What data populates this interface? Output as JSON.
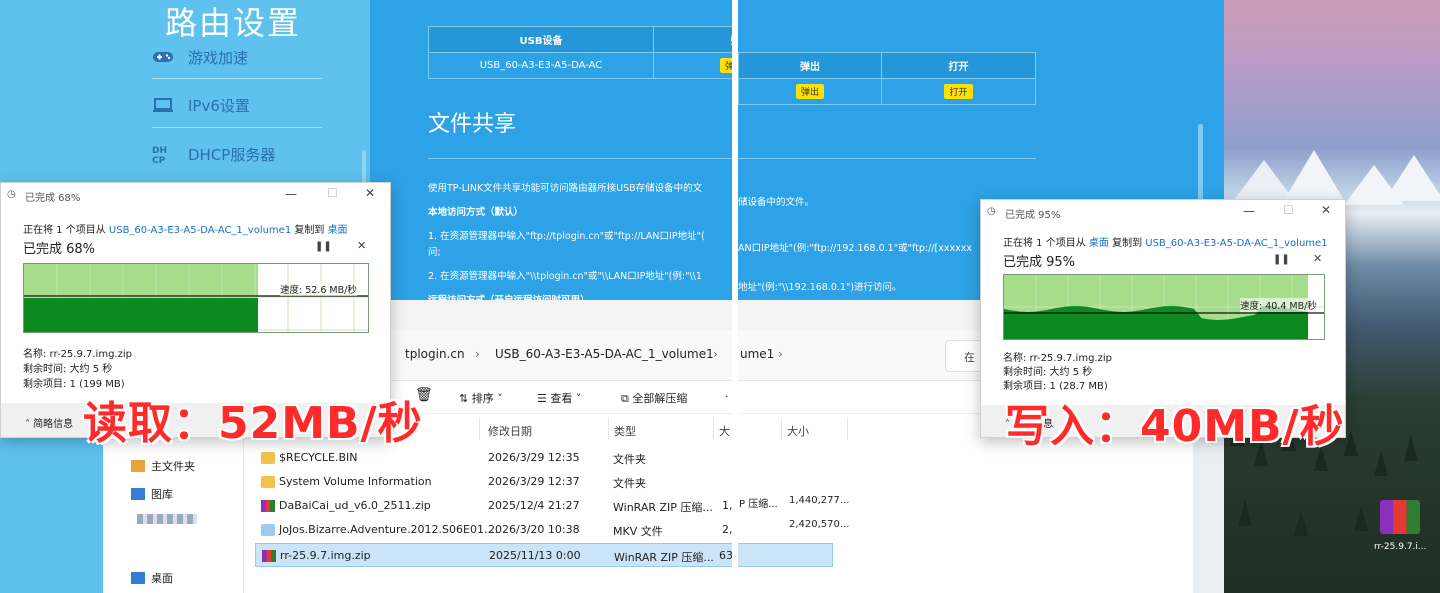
{
  "router_left": {
    "title": "路由设置",
    "nav": [
      {
        "label": "游戏加速",
        "icon": "gamepad-icon"
      },
      {
        "label": "IPv6设置",
        "icon": "monitor-icon"
      },
      {
        "label": "DHCP服务器",
        "icon": "dhcp-icon"
      }
    ]
  },
  "router_main": {
    "usb_table": {
      "headers": [
        "USB设备",
        "弹出",
        "打开"
      ],
      "device": "USB_60-A3-E3-A5-DA-AC",
      "eject": "弹出",
      "open": "打开"
    },
    "file_share_title": "文件共享",
    "desc": "使用TP-LINK文件共享功能可访问路由器所接USB存储设备中的文",
    "desc_right": "储设备中的文件。",
    "local_title": "本地访问方式（默认）",
    "step1": "1. 在资源管理器中输入\"ftp://tplogin.cn\"或\"ftp://LAN口IP地址\"(",
    "step1_right": "AN口IP地址\"(例:\"ftp://192.168.0.1\"或\"ftp://[xxxxxx",
    "step1_b": "问;",
    "step2": "2. 在资源管理器中输入\"\\\\tplogin.cn\"或\"\\\\LAN口IP地址\"(例:\"\\\\1",
    "step2_right": "地址\"(例:\"\\\\192.168.0.1\")进行访问。",
    "remote_title": "远程访问方式（开启远程访问时可用）"
  },
  "explorer": {
    "breadcrumb": [
      "tplogin.cn",
      "USB_60-A3-E3-A5-DA-AC_1_volume1",
      "ume1"
    ],
    "search_hint": "在",
    "commands": {
      "sort": "排序",
      "view": "查看",
      "extract": "全部解压缩"
    },
    "sidebar": [
      "主文件夹",
      "图库",
      "桌面"
    ],
    "columns": [
      "修改日期",
      "类型",
      "大",
      "大小"
    ],
    "files": [
      {
        "name": "$RECYCLE.BIN",
        "date": "2026/3/29 12:35",
        "type": "文件夹",
        "size": "",
        "kind": "folder"
      },
      {
        "name": "System Volume Information",
        "date": "2026/3/29 12:37",
        "type": "文件夹",
        "size": "",
        "kind": "folder"
      },
      {
        "name": "DaBaiCai_ud_v6.0_2511.zip",
        "date": "2025/12/4 21:27",
        "type": "WinRAR ZIP 压缩...",
        "size": "1,",
        "kind": "zip"
      },
      {
        "name": "JoJos.Bizarre.Adventure.2012.S06E01....",
        "date": "2026/3/20 10:38",
        "type": "MKV 文件",
        "size": "2,",
        "kind": "mkv"
      },
      {
        "name": "rr-25.9.7.img.zip",
        "date": "2025/11/13 0:00",
        "type": "WinRAR ZIP 压缩...",
        "size": "63",
        "kind": "zip"
      }
    ],
    "right_rows": [
      {
        "type": "P 压缩...",
        "size": "1,440,277..."
      },
      {
        "type": "",
        "size": "2,420,570..."
      }
    ]
  },
  "read_dialog": {
    "title": "已完成 68%",
    "copy_line_a": "正在将 1 个项目从 ",
    "source": "USB_60-A3-E3-A5-DA-AC_1_volume1",
    "copy_line_b": " 复制到 ",
    "dest": "桌面",
    "done": "已完成 68%",
    "progress": 0.68,
    "speed": "速度: 52.6 MB/秒",
    "name": "名称: rr-25.9.7.img.zip",
    "remaining_time": "剩余时间: 大约 5 秒",
    "remaining_items": "剩余项目: 1 (199 MB)",
    "less_info": "简略信息"
  },
  "write_dialog": {
    "title": "已完成 95%",
    "copy_line_a": "正在将 1 个项目从 ",
    "source": "桌面",
    "copy_line_b": " 复制到 ",
    "dest": "USB_60-A3-E3-A5-DA-AC_1_volume1",
    "done": "已完成 95%",
    "progress": 0.95,
    "speed": "速度: 40.4 MB/秒",
    "name": "名称: rr-25.9.7.img.zip",
    "remaining_time": "剩余时间: 大约 5 秒",
    "remaining_items": "剩余项目: 1 (28.7 MB)",
    "less_info": "简略信息"
  },
  "overlays": {
    "read": "读取：52MB/秒",
    "write": "写入：40MB/秒"
  },
  "desktop_icon_label": "rr-25.9.7.i...",
  "colors": {
    "router_blue": "#2ea2e6",
    "router_side": "#5ec1ee",
    "graph_fill": "#0c8a1f",
    "accent_red": "#ff2a2a"
  }
}
